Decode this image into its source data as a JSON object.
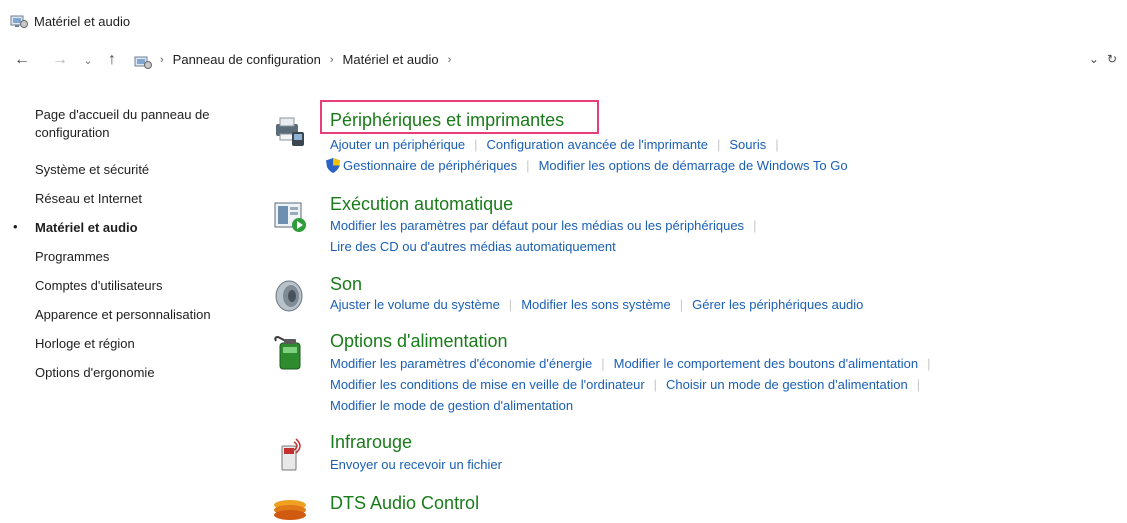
{
  "window": {
    "title": "Matériel et audio"
  },
  "nav": {
    "breadcrumb": [
      "Panneau de configuration",
      "Matériel et audio"
    ],
    "right_glyphs": [
      "⌄",
      "↻"
    ]
  },
  "sidebar": {
    "items": [
      {
        "label": "Page d'accueil du panneau de configuration",
        "current": false
      },
      {
        "label": "Système et sécurité",
        "current": false
      },
      {
        "label": "Réseau et Internet",
        "current": false
      },
      {
        "label": "Matériel et audio",
        "current": true
      },
      {
        "label": "Programmes",
        "current": false
      },
      {
        "label": "Comptes d'utilisateurs",
        "current": false
      },
      {
        "label": "Apparence et personnalisation",
        "current": false
      },
      {
        "label": "Horloge et région",
        "current": false
      },
      {
        "label": "Options d'ergonomie",
        "current": false
      }
    ]
  },
  "categories": [
    {
      "title": "Périphériques et imprimantes",
      "icon": "devices-printers-icon",
      "highlighted": true,
      "link_rows": [
        [
          "Ajouter un périphérique",
          "Configuration avancée de l'imprimante",
          "Souris"
        ],
        [
          "Gestionnaire de périphériques",
          "Modifier les options de démarrage de Windows To Go"
        ]
      ]
    },
    {
      "title": "Exécution automatique",
      "icon": "autoplay-icon",
      "link_rows": [
        [
          "Modifier les paramètres par défaut pour les médias ou les périphériques"
        ],
        [
          "Lire des CD ou d'autres médias automatiquement"
        ]
      ]
    },
    {
      "title": "Son",
      "icon": "speaker-icon",
      "link_rows": [
        [
          "Ajuster le volume du système",
          "Modifier les sons système",
          "Gérer les périphériques audio"
        ]
      ]
    },
    {
      "title": "Options d'alimentation",
      "icon": "battery-icon",
      "link_rows": [
        [
          "Modifier les paramètres d'économie d'énergie",
          "Modifier le comportement des boutons d'alimentation"
        ],
        [
          "Modifier les conditions de mise en veille de l'ordinateur",
          "Choisir un mode de gestion d'alimentation"
        ],
        [
          "Modifier le mode de gestion d'alimentation"
        ]
      ]
    },
    {
      "title": "Infrarouge",
      "icon": "infrared-icon",
      "link_rows": [
        [
          "Envoyer ou recevoir un fichier"
        ]
      ]
    },
    {
      "title": "DTS Audio Control",
      "icon": "dts-audio-icon",
      "link_rows": []
    }
  ],
  "colors": {
    "category_title": "#1a7b1a",
    "link": "#1a5fb4",
    "highlight_box": "#e83e78"
  }
}
